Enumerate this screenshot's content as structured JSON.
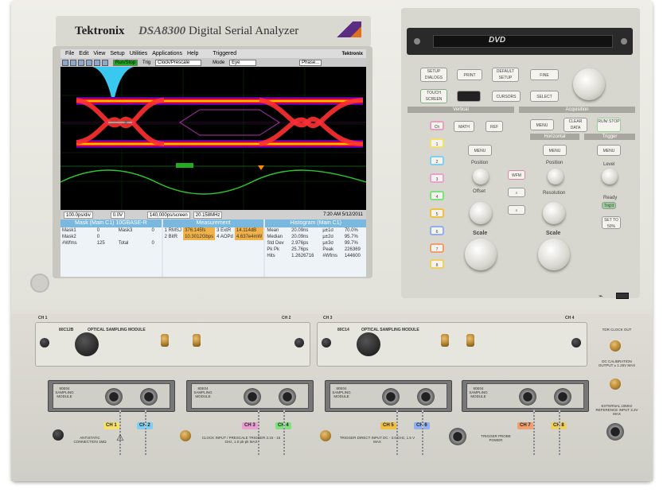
{
  "instrument": {
    "brand": "Tektronix",
    "model": "DSA8300",
    "model_desc": "Digital Serial Analyzer"
  },
  "screen": {
    "menu": [
      "File",
      "Edit",
      "View",
      "Setup",
      "Utilities",
      "Applications",
      "Help",
      "Triggered"
    ],
    "logo": "Tektronix",
    "toolbar": {
      "trig_label": "Trig",
      "trig_value": "Clock/Prescale",
      "mode_label": "Mode",
      "mode_value": "Eye",
      "run_label": "Run/Stop",
      "sync_label": "Phase..."
    },
    "statusbar": {
      "timebase": "100.0ps/div",
      "vertical": "0.0V",
      "sample": "140,000ps/screen",
      "rate": "20.158MHz",
      "time": "7:20 AM 5/12/2011"
    },
    "mask_panel": {
      "title": "Mask (Main C1) 10GBASE-R",
      "rows": [
        [
          "Mask1",
          "0",
          "Mask3",
          "0"
        ],
        [
          "Mask2",
          "0",
          "",
          ""
        ],
        [
          "#Wfms",
          "125",
          "Total",
          "0"
        ]
      ]
    },
    "meas_panel": {
      "title": "Measurement",
      "rows": [
        [
          "1 RMSJ",
          "376.145fs",
          "3 ExtR",
          "14.114dB"
        ],
        [
          "2 BitR",
          "10.3012Gbps",
          "4 AOPd",
          "4.637e4mW"
        ]
      ]
    },
    "hist_panel": {
      "title": "Histogram (Main C1)",
      "rows": [
        [
          "Mean",
          "20.09ns",
          "μ±1σ",
          "70.0%"
        ],
        [
          "Median",
          "20.09ns",
          "μ±2σ",
          "95.7%"
        ],
        [
          "Std Dev",
          "2.976ps",
          "μ±3σ",
          "99.7%"
        ],
        [
          "Pk Pk",
          "25.76ps",
          "Peak",
          "226369"
        ],
        [
          "Hits",
          "1.2626716",
          "#Wfms",
          "144600"
        ]
      ]
    }
  },
  "front_panel": {
    "dvd_logo": "DVD",
    "buttons": {
      "setup": "SETUP DIALOGS",
      "print": "PRINT",
      "default": "DEFAULT SETUP",
      "fine": "FINE",
      "touch": "TOUCH SCREEN",
      "cursors": "CURSORS",
      "select": "SELECT",
      "vertical_title": "Vertical",
      "acquisition_title": "Acquisition",
      "menu": "MENU",
      "clear": "CLEAR DATA",
      "run": "RUN/ STOP",
      "horizontal_title": "Horizontal",
      "trigger_title": "Trigger",
      "position": "Position",
      "offset": "Offset",
      "scale": "Scale",
      "resolution": "Resolution",
      "level": "Level",
      "ready": "Ready",
      "trigd": "Trig'd",
      "set50": "SET TO 50%",
      "wfm": "WFM",
      "channels": [
        "Ch",
        "1",
        "2",
        "3",
        "4",
        "5",
        "6",
        "7",
        "8"
      ]
    }
  },
  "modules": {
    "opt1": {
      "name": "80C12B",
      "label": "OPTICAL SAMPLING MODULE",
      "ch_left": "CH 1",
      "ch_right": "CH 2"
    },
    "opt2": {
      "name": "80C14",
      "label": "OPTICAL SAMPLING MODULE",
      "ch_left": "CH 3",
      "ch_right": "CH 4"
    },
    "tdr_clock": "TDR CLOCK OUT",
    "dc_cal": "DC CALIBRATION OUTPUT ± 1.25V MAX",
    "ext_ref": "EXTERNAL 10MHz REFERENCE INPUT 3.3V MAX",
    "antistatic": "ANTISTATIC CONNECTION 1MΩ",
    "clock_input": "CLOCK INPUT / PRESCALE TRIGGER 3.15 - 15 GHz, 1.0 pk-pk MAX",
    "trigger_direct": "TRIGGER DIRECT INPUT DC - 3.0 GHz, 1.5 V MAX",
    "trigger_probe": "TRIGGER PROBE POWER",
    "electrical": [
      {
        "name": "80E04 SAMPLING MODULE",
        "ch_a": "CH 1",
        "ch_b": "CH 2"
      },
      {
        "name": "80E04 SAMPLING MODULE",
        "ch_a": "CH 3",
        "ch_b": "CH 4"
      },
      {
        "name": "80E04 SAMPLING MODULE",
        "ch_a": "CH 5",
        "ch_b": "CH 6"
      },
      {
        "name": "80E04 SAMPLING MODULE",
        "ch_a": "CH 7",
        "ch_b": "CH 8"
      }
    ]
  },
  "colors": {
    "ch1": "#f4e06a",
    "ch2": "#7fd0f0",
    "ch3": "#e7a0d0",
    "ch4": "#7fe07f",
    "ch5": "#f0c040",
    "ch6": "#90b0f0",
    "ch7": "#f0a070",
    "ch8": "#f0d060"
  }
}
